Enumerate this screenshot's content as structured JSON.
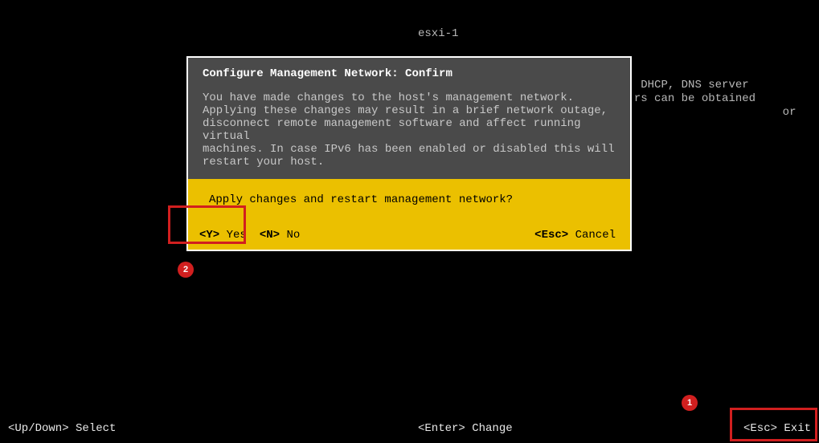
{
  "background": {
    "hostname": "esxi-1",
    "info_text": "If this host is configured using DHCP, DNS server addresses and other DNS parameters can be obtained automatically. If                                     or for the appropriate"
  },
  "dialog": {
    "title": "Configure Management Network: Confirm",
    "body": "You have made changes to the host's management network.\nApplying these changes may result in a brief network outage,\ndisconnect remote management software and affect running virtual\nmachines. In case IPv6 has been enabled or disabled this will\nrestart your host.",
    "question": "Apply changes and restart management network?",
    "actions": {
      "yes_key": "<Y>",
      "yes_label": " Yes",
      "no_key": "<N>",
      "no_label": " No",
      "cancel_key": "<Esc>",
      "cancel_label": " Cancel"
    }
  },
  "footer": {
    "left": "<Up/Down> Select",
    "center": "<Enter> Change",
    "right": "<Esc> Exit"
  },
  "annotations": {
    "callout1": "1",
    "callout2": "2"
  }
}
